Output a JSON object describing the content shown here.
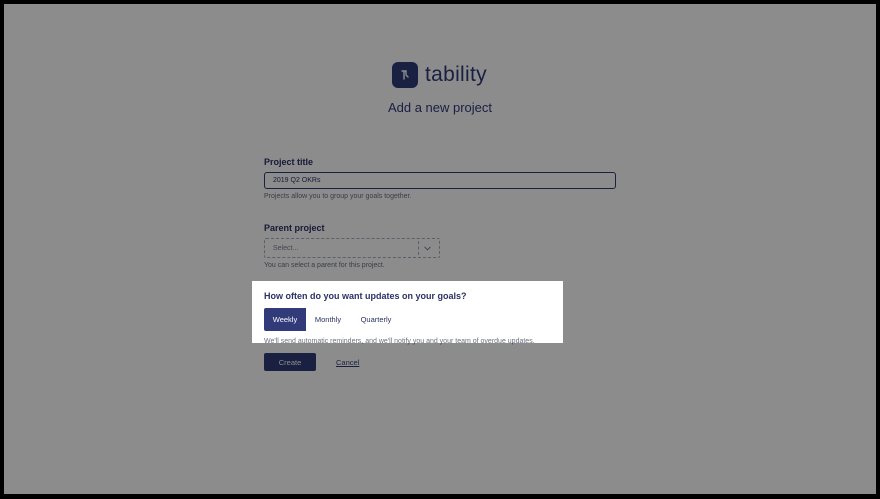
{
  "brand": {
    "name": "tability"
  },
  "page": {
    "title": "Add a new project"
  },
  "form": {
    "project_title": {
      "label": "Project title",
      "value": "2019 Q2 OKRs",
      "hint": "Projects allow you to group your goals together."
    },
    "parent_project": {
      "label": "Parent project",
      "placeholder": "Select...",
      "hint": "You can select a parent for this project."
    },
    "update_frequency": {
      "label": "How often do you want updates on your goals?",
      "options": [
        "Weekly",
        "Monthly",
        "Quarterly"
      ],
      "selected": "Weekly",
      "hint": "We'll send automatic reminders, and we'll notify you and your team of overdue updates."
    },
    "actions": {
      "create_label": "Create",
      "cancel_label": "Cancel"
    }
  },
  "colors": {
    "primary": "#313b79",
    "overlay": "rgba(0,0,0,0.45)"
  }
}
